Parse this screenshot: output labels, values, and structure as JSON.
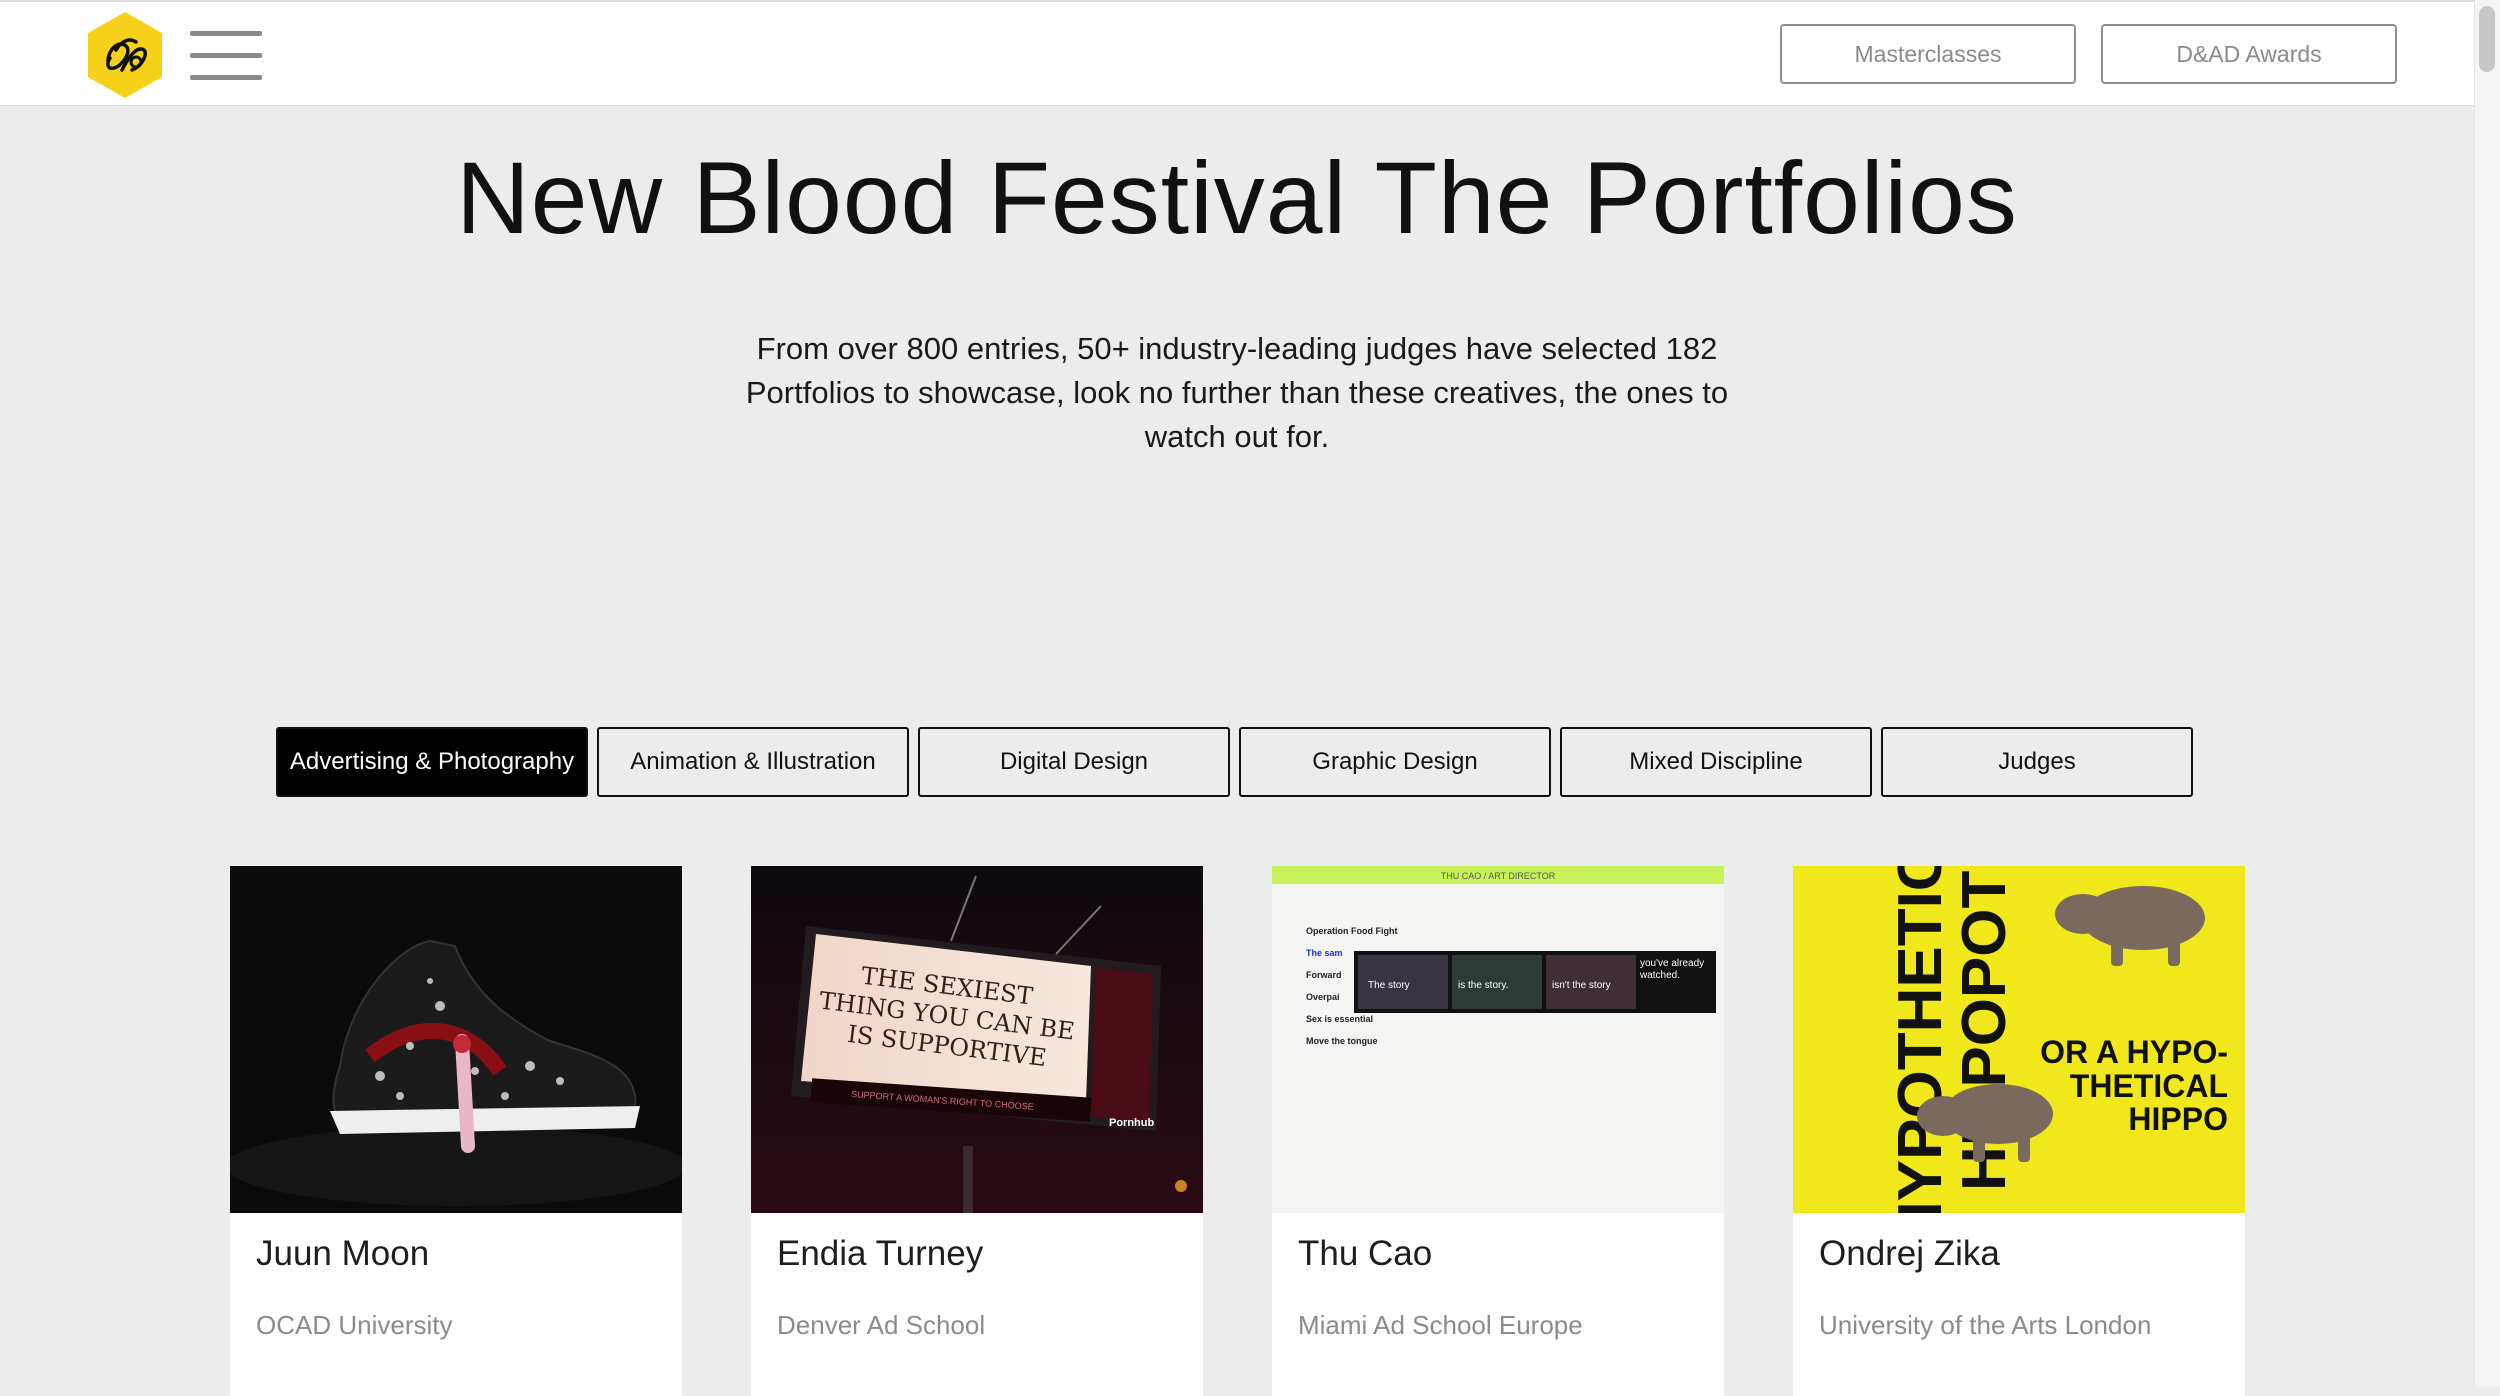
{
  "header": {
    "masterclasses_label": "Masterclasses",
    "awards_label": "D&AD Awards"
  },
  "hero": {
    "title": "New Blood Festival The Portfolios",
    "intro": "From over 800 entries, 50+ industry-leading judges have selected 182 Portfolios to showcase, look no further than these creatives, the ones to watch out for."
  },
  "tabs": [
    {
      "label": "Advertising & Photography",
      "active": true
    },
    {
      "label": "Animation & Illustration",
      "active": false
    },
    {
      "label": "Digital Design",
      "active": false
    },
    {
      "label": "Graphic Design",
      "active": false
    },
    {
      "label": "Mixed Discipline",
      "active": false
    },
    {
      "label": "Judges",
      "active": false
    }
  ],
  "cards": [
    {
      "name": "Juun Moon",
      "school": "OCAD University"
    },
    {
      "name": "Endia Turney",
      "school": "Denver Ad School",
      "image_text": {
        "billboard": [
          "THE SEXIEST",
          "THING YOU CAN BE",
          "IS SUPPORTIVE"
        ],
        "tagline": "SUPPORT A WOMAN'S RIGHT TO CHOOSE",
        "brand": "Pornhub"
      }
    },
    {
      "name": "Thu Cao",
      "school": "Miami Ad School Europe",
      "image_text": {
        "header": "THU CAO / ART DIRECTOR",
        "items": [
          "Operation Food Fight",
          "The sam",
          "Forward",
          "Overpai",
          "Sex is essential",
          "Move the tongue"
        ],
        "strip": [
          "The story",
          "is the story.",
          "isn't the story",
          "you've already watched."
        ]
      }
    },
    {
      "name": "Ondrej Zika",
      "school": "University of the Arts London",
      "image_text": {
        "vertical_1": "HYPOTHETIC",
        "vertical_2": "HIPPOPOT",
        "headline": [
          "OR A HYPO-",
          "THETICAL",
          "HIPPO"
        ]
      }
    }
  ],
  "colors": {
    "logo_yellow": "#f6d11a",
    "background": "#ececec",
    "active_tab": "#000000",
    "hippo_yellow": "#f1e81c",
    "thu_green": "#c9f25a"
  }
}
